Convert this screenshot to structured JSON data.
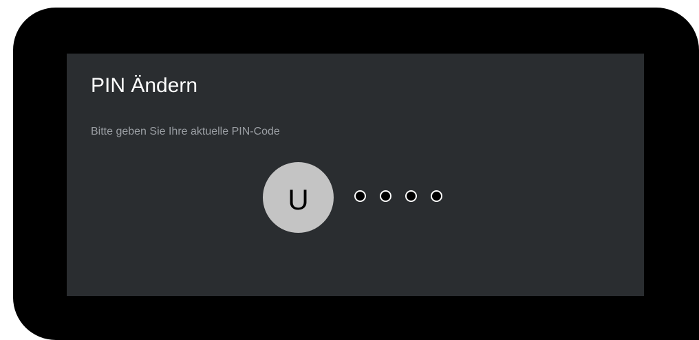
{
  "dialog": {
    "title": "PIN Ändern",
    "subtitle": "Bitte geben Sie Ihre aktuelle PIN-Code"
  },
  "profile": {
    "avatar_letter": "U"
  },
  "pin_entry": {
    "total_digits": 4,
    "entered_digits": 0
  },
  "colors": {
    "frame": "#000000",
    "panel": "#2a2d30",
    "title_text": "#ffffff",
    "subtitle_text": "#9a9ea3",
    "avatar_bg": "#c4c4c4",
    "dot_border": "#ffffff",
    "dot_fill": "#000000"
  }
}
